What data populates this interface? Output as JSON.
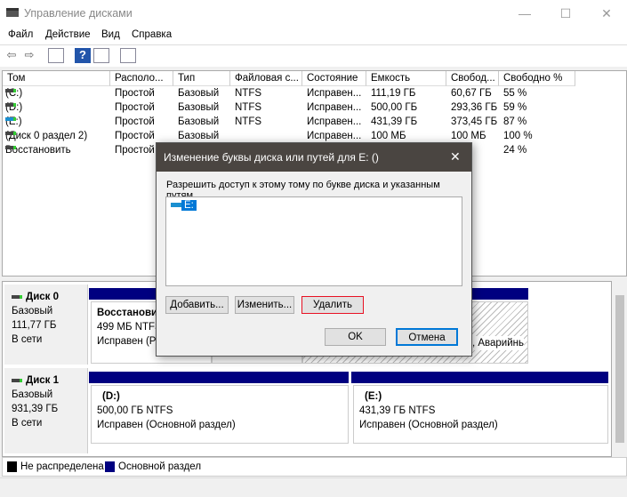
{
  "window": {
    "title": "Управление дисками",
    "minimize": "—",
    "maximize": "☐",
    "close": "✕"
  },
  "menu": [
    "Файл",
    "Действие",
    "Вид",
    "Справка"
  ],
  "table": {
    "columns": [
      "Том",
      "Располо...",
      "Тип",
      "Файловая с...",
      "Состояние",
      "Емкость",
      "Свобод...",
      "Свободно %"
    ],
    "rows": [
      [
        "(C:)",
        "Простой",
        "Базовый",
        "NTFS",
        "Исправен...",
        "111,19 ГБ",
        "60,67 ГБ",
        "55 %"
      ],
      [
        "(D:)",
        "Простой",
        "Базовый",
        "NTFS",
        "Исправен...",
        "500,00 ГБ",
        "293,36 ГБ",
        "59 %"
      ],
      [
        "(E:)",
        "Простой",
        "Базовый",
        "NTFS",
        "Исправен...",
        "431,39 ГБ",
        "373,45 ГБ",
        "87 %"
      ],
      [
        "(Диск 0 раздел 2)",
        "Простой",
        "Базовый",
        "",
        "Исправен...",
        "100 МБ",
        "100 МБ",
        "100 %"
      ],
      [
        "Восстановить",
        "Простой",
        "",
        "",
        "",
        "",
        "МБ",
        "24 %"
      ]
    ]
  },
  "disks": [
    {
      "name": "Диск 0",
      "type": "Базовый",
      "size": "111,77 ГБ",
      "status": "В сети",
      "partitions": [
        {
          "name": "Восстановит",
          "info": "499 МБ NTFS",
          "state": "Исправен (Ра"
        },
        {
          "name": "",
          "info": "",
          "state": ""
        },
        {
          "name": "",
          "info": "",
          "state": ", Аварийнь"
        }
      ]
    },
    {
      "name": "Диск 1",
      "type": "Базовый",
      "size": "931,39 ГБ",
      "status": "В сети",
      "partitions": [
        {
          "name": "(D:)",
          "info": "500,00 ГБ NTFS",
          "state": "Исправен (Основной раздел)"
        },
        {
          "name": "(E:)",
          "info": "431,39 ГБ NTFS",
          "state": "Исправен (Основной раздел)"
        }
      ]
    }
  ],
  "legend": [
    {
      "label": "Не распределена",
      "color": "#000000"
    },
    {
      "label": "Основной раздел",
      "color": "#000080"
    }
  ],
  "dialog": {
    "title": "Изменение буквы диска или путей для E: ()",
    "close": "✕",
    "description": "Разрешить доступ к этому тому по букве диска и указанным путям.",
    "paths": [
      "E:"
    ],
    "add": "Добавить...",
    "change": "Изменить...",
    "remove": "Удалить",
    "ok": "OK",
    "cancel": "Отмена"
  }
}
